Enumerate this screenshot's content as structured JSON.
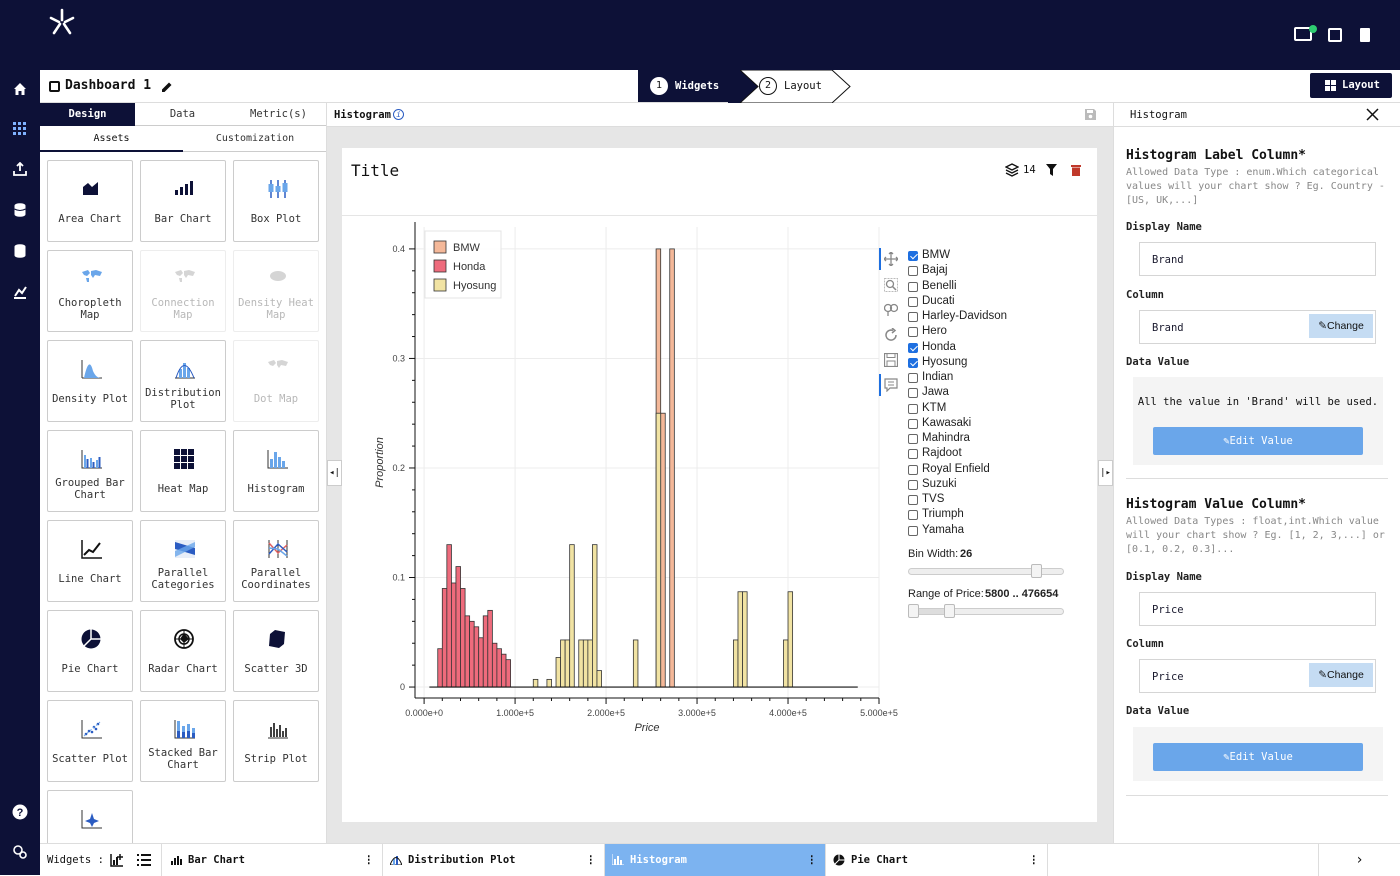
{
  "dashboard": {
    "title": "Dashboard 1"
  },
  "steps": [
    {
      "num": "1",
      "label": "Widgets"
    },
    {
      "num": "2",
      "label": "Layout"
    }
  ],
  "layout_button": "Layout",
  "left_panel": {
    "tabs": [
      "Design",
      "Data",
      "Metric(s)"
    ],
    "subtabs": [
      "Assets",
      "Customization"
    ],
    "tiles": [
      {
        "label": "Area Chart",
        "disabled": false
      },
      {
        "label": "Bar Chart",
        "disabled": false
      },
      {
        "label": "Box Plot",
        "disabled": false
      },
      {
        "label": "Choropleth Map",
        "disabled": false
      },
      {
        "label": "Connection Map",
        "disabled": true
      },
      {
        "label": "Density Heat Map",
        "disabled": true
      },
      {
        "label": "Density Plot",
        "disabled": false
      },
      {
        "label": "Distribution Plot",
        "disabled": false
      },
      {
        "label": "Dot Map",
        "disabled": true
      },
      {
        "label": "Grouped Bar Chart",
        "disabled": false
      },
      {
        "label": "Heat Map",
        "disabled": false
      },
      {
        "label": "Histogram",
        "disabled": false
      },
      {
        "label": "Line Chart",
        "disabled": false
      },
      {
        "label": "Parallel Categories",
        "disabled": false
      },
      {
        "label": "Parallel Coordinates",
        "disabled": false
      },
      {
        "label": "Pie Chart",
        "disabled": false
      },
      {
        "label": "Radar Chart",
        "disabled": false
      },
      {
        "label": "Scatter 3D",
        "disabled": false
      },
      {
        "label": "Scatter Plot",
        "disabled": false
      },
      {
        "label": "Stacked Bar Chart",
        "disabled": false
      },
      {
        "label": "Strip Plot",
        "disabled": false
      },
      {
        "label": "",
        "disabled": false
      }
    ]
  },
  "center": {
    "header": "Histogram",
    "card_title": "Title",
    "layers_count": "14",
    "brands": [
      {
        "name": "BMW",
        "checked": true
      },
      {
        "name": "Bajaj",
        "checked": false
      },
      {
        "name": "Benelli",
        "checked": false
      },
      {
        "name": "Ducati",
        "checked": false
      },
      {
        "name": "Harley-Davidson",
        "checked": false
      },
      {
        "name": "Hero",
        "checked": false
      },
      {
        "name": "Honda",
        "checked": true
      },
      {
        "name": "Hyosung",
        "checked": true
      },
      {
        "name": "Indian",
        "checked": false
      },
      {
        "name": "Jawa",
        "checked": false
      },
      {
        "name": "KTM",
        "checked": false
      },
      {
        "name": "Kawasaki",
        "checked": false
      },
      {
        "name": "Mahindra",
        "checked": false
      },
      {
        "name": "Rajdoot",
        "checked": false
      },
      {
        "name": "Royal Enfield",
        "checked": false
      },
      {
        "name": "Suzuki",
        "checked": false
      },
      {
        "name": "TVS",
        "checked": false
      },
      {
        "name": "Triumph",
        "checked": false
      },
      {
        "name": "Yamaha",
        "checked": false
      }
    ],
    "bin_width_label": "Bin Width:",
    "bin_width_value": "26",
    "bin_width_level": 0.85,
    "range_label": "Range of Price:",
    "range_value": "5800 .. 476654",
    "range_level": [
      0.0,
      0.25
    ]
  },
  "chart_data": {
    "type": "bar",
    "title": "",
    "xlabel": "Price",
    "ylabel": "Proportion",
    "xlim": [
      -10000,
      500000
    ],
    "ylim": [
      -0.01,
      0.42
    ],
    "x_ticks": [
      "0.000e+0",
      "1.000e+5",
      "2.000e+5",
      "3.000e+5",
      "4.000e+5",
      "5.000e+5"
    ],
    "y_ticks": [
      "0",
      "0.1",
      "0.2",
      "0.3",
      "0.4"
    ],
    "legend_position": "top-left",
    "bin_width": 5050,
    "series": [
      {
        "name": "BMW",
        "color": "#f4b899",
        "bins": [
          [
            255000,
            0.4
          ],
          [
            260000,
            0.25
          ],
          [
            270000,
            0.4
          ]
        ]
      },
      {
        "name": "Honda",
        "color": "#ee6b7c",
        "bins": [
          [
            15000,
            0.035
          ],
          [
            20000,
            0.09
          ],
          [
            25000,
            0.13
          ],
          [
            30000,
            0.095
          ],
          [
            35000,
            0.11
          ],
          [
            40000,
            0.09
          ],
          [
            45000,
            0.065
          ],
          [
            50000,
            0.06
          ],
          [
            55000,
            0.055
          ],
          [
            60000,
            0.045
          ],
          [
            65000,
            0.065
          ],
          [
            70000,
            0.07
          ],
          [
            75000,
            0.04
          ],
          [
            80000,
            0.035
          ],
          [
            85000,
            0.03
          ],
          [
            90000,
            0.025
          ]
        ]
      },
      {
        "name": "Hyosung",
        "color": "#f1e3a3",
        "bins": [
          [
            120000,
            0.007
          ],
          [
            135000,
            0.007
          ],
          [
            145000,
            0.027
          ],
          [
            150000,
            0.043
          ],
          [
            155000,
            0.043
          ],
          [
            160000,
            0.13
          ],
          [
            170000,
            0.043
          ],
          [
            175000,
            0.043
          ],
          [
            180000,
            0.043
          ],
          [
            185000,
            0.13
          ],
          [
            190000,
            0.015
          ],
          [
            230000,
            0.043
          ],
          [
            255000,
            0.25
          ],
          [
            340000,
            0.043
          ],
          [
            345000,
            0.087
          ],
          [
            350000,
            0.087
          ],
          [
            395000,
            0.043
          ],
          [
            400000,
            0.087
          ]
        ]
      }
    ]
  },
  "right_panel": {
    "header": "Histogram",
    "label_col": {
      "heading": "Histogram Label Column*",
      "help": "Allowed Data Type : enum.Which categorical values will your chart show ? Eg. Country - [US, UK,...]",
      "display_name_label": "Display Name",
      "display_name": "Brand",
      "column_label": "Column",
      "column": "Brand",
      "change": "Change",
      "data_value_label": "Data Value",
      "data_value_text": "All the value in 'Brand' will be used.",
      "edit": "Edit Value"
    },
    "value_col": {
      "heading": "Histogram Value Column*",
      "help": "Allowed Data Types : float,int.Which value will your chart show ? Eg. [1, 2, 3,...] or [0.1, 0.2, 0.3]...",
      "display_name_label": "Display Name",
      "display_name": "Price",
      "column_label": "Column",
      "column": "Price",
      "change": "Change",
      "data_value_label": "Data Value",
      "edit": "Edit Value"
    }
  },
  "bottom": {
    "widgets_label": "Widgets :",
    "tabs": [
      {
        "label": "Bar Chart",
        "active": false
      },
      {
        "label": "Distribution Plot",
        "active": false
      },
      {
        "label": "Histogram",
        "active": true
      },
      {
        "label": "Pie Chart",
        "active": false
      }
    ]
  }
}
